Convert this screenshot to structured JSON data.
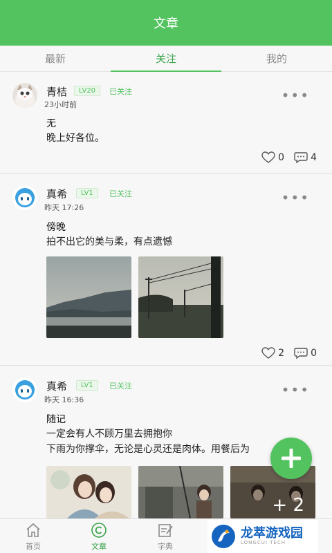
{
  "header": {
    "title": "文章"
  },
  "tabs": [
    {
      "label": "最新",
      "active": false
    },
    {
      "label": "关注",
      "active": true
    },
    {
      "label": "我的",
      "active": false
    }
  ],
  "posts": [
    {
      "author": "青桔",
      "level": "LV20",
      "follow": "已关注",
      "time": "23小时前",
      "title": "无",
      "body": [
        "晚上好各位。"
      ],
      "likes": "0",
      "comments": "4"
    },
    {
      "author": "真希",
      "level": "LV1",
      "follow": "已关注",
      "time": "昨天 17:26",
      "title": "傍晚",
      "body": [
        "拍不出它的美与柔，有点遗憾"
      ],
      "likes": "2",
      "comments": "0"
    },
    {
      "author": "真希",
      "level": "LV1",
      "follow": "已关注",
      "time": "昨天 16:36",
      "title": "随记",
      "body": [
        "一定会有人不顾万里去拥抱你",
        "下雨为你撑伞，无论是心灵还是肉体。用餐后为"
      ],
      "extra_images": "+ 2"
    }
  ],
  "bottom_nav": [
    {
      "label": "首页",
      "icon": "home-icon",
      "active": false
    },
    {
      "label": "文章",
      "icon": "article-icon",
      "active": true
    },
    {
      "label": "字典",
      "icon": "dictionary-icon",
      "active": false
    }
  ],
  "watermark": {
    "name": "龙萃游戏园",
    "sub": "LONGCUI TECH"
  },
  "colors": {
    "brand": "#52c35f",
    "accent_text": "#3aa34a"
  }
}
